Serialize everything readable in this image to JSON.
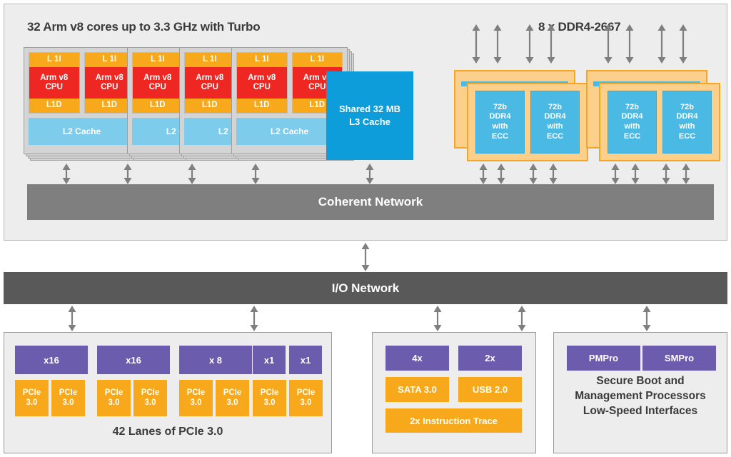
{
  "soc": {
    "cores_title": "32 Arm v8 cores up to 3.3 GHz with Turbo",
    "ddr_title": "8 x DDR4-2667",
    "cluster": {
      "l1i_label": "L 1I",
      "cpu_line1": "Arm v8",
      "cpu_line2": "CPU",
      "l1d_label": "L1D",
      "l2_label": "L2 Cache"
    },
    "l3_cache": {
      "line1": "Shared 32 MB",
      "line2": "L3 Cache"
    },
    "ddr_chip": {
      "line1": "72b",
      "line2": "DDR4",
      "line3": "with",
      "line4": "ECC"
    },
    "coherent_network_label": "Coherent Network"
  },
  "io_network_label": "I/O Network",
  "pcie_panel": {
    "lane_widths": [
      "x16",
      "x16",
      "x 8",
      "x1",
      "x1"
    ],
    "controllers": [
      {
        "line1": "PCIe",
        "line2": "3.0"
      },
      {
        "line1": "PCIe",
        "line2": "3.0"
      },
      {
        "line1": "PCIe",
        "line2": "3.0"
      },
      {
        "line1": "PCIe",
        "line2": "3.0"
      },
      {
        "line1": "PCIe",
        "line2": "3.0"
      },
      {
        "line1": "PCIe",
        "line2": "3.0"
      },
      {
        "line1": "PCIe",
        "line2": "3.0"
      },
      {
        "line1": "PCIe",
        "line2": "3.0"
      }
    ],
    "caption": "42 Lanes of PCIe 3.0"
  },
  "io_panel": {
    "counts": [
      "4x",
      "2x"
    ],
    "interfaces": [
      "SATA 3.0",
      "USB 2.0"
    ],
    "trace": "2x Instruction Trace"
  },
  "mgmt_panel": {
    "processors": [
      "PMPro",
      "SMPro"
    ],
    "caption_line1": "Secure Boot and",
    "caption_line2": "Management Processors",
    "caption_line3": "Low-Speed Interfaces"
  },
  "colors": {
    "panel_bg": "#ededed",
    "cpu_red": "#ee2722",
    "cache_orange": "#f7a81b",
    "l2_blue": "#7dcceb",
    "l3_blue": "#0d9ddb",
    "ddr_card": "#fcd08b",
    "ddr_border": "#f5a623",
    "ddr_chip": "#4ab9e3",
    "coherent_gray": "#7f7f7f",
    "io_gray": "#595959",
    "purple": "#6b5cad",
    "arrow_gray": "#7f7f7f"
  }
}
